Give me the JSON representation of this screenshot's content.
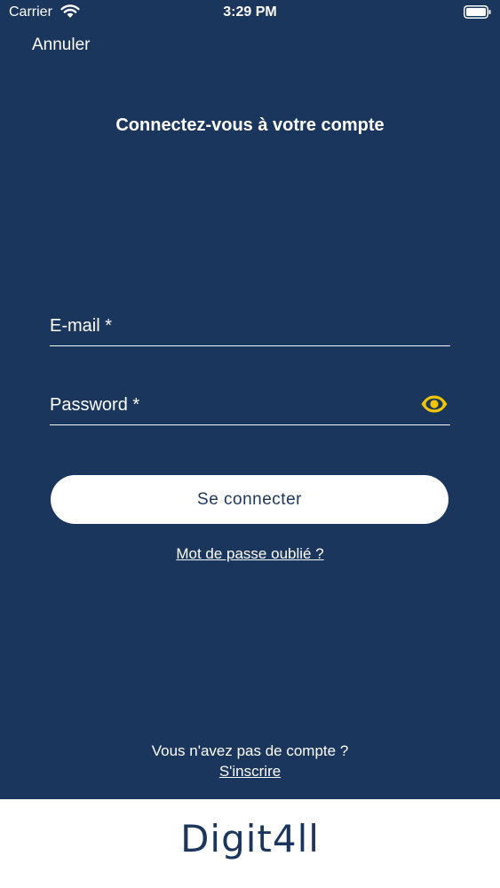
{
  "status_bar": {
    "carrier": "Carrier",
    "time": "3:29 PM"
  },
  "nav": {
    "cancel_label": "Annuler"
  },
  "page": {
    "title": "Connectez-vous à votre compte"
  },
  "form": {
    "email_placeholder": "E-mail *",
    "email_value": "",
    "password_placeholder": "Password *",
    "password_value": "",
    "submit_label": "Se connecter",
    "forgot_label": "Mot de passe oublié ?"
  },
  "signup": {
    "prompt": "Vous n'avez pas de compte ?",
    "link_label": "S'inscrire"
  },
  "footer": {
    "logo_text": "Digit4ll"
  },
  "icons": {
    "wifi": "wifi-icon",
    "battery": "battery-icon",
    "eye": "eye-icon"
  },
  "colors": {
    "background": "#1b365d",
    "accent": "#f2c500",
    "button_bg": "#ffffff",
    "button_text": "#1b365d"
  }
}
